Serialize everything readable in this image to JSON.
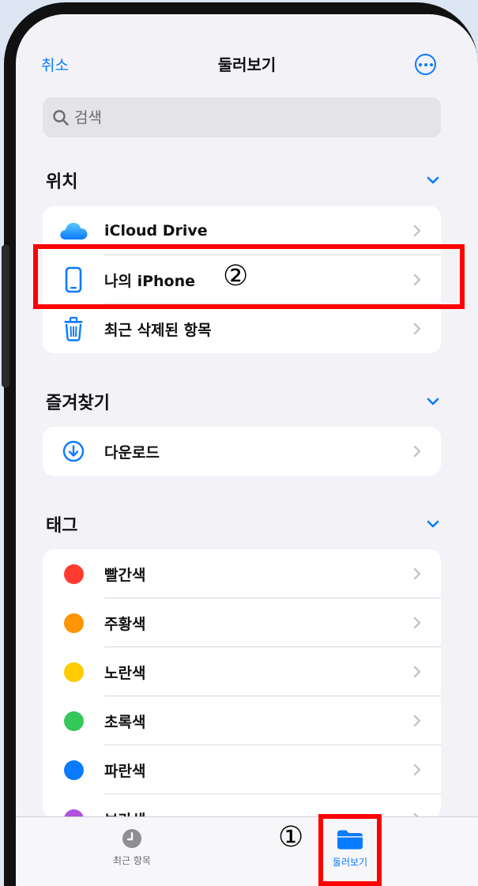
{
  "header": {
    "cancel_label": "취소",
    "title": "둘러보기"
  },
  "search": {
    "placeholder": "검색"
  },
  "sections": {
    "locations": {
      "title": "위치",
      "items": [
        {
          "label": "iCloud Drive",
          "icon": "icloud-icon"
        },
        {
          "label": "나의 iPhone",
          "icon": "iphone-icon"
        },
        {
          "label": "최근 삭제된 항목",
          "icon": "trash-icon"
        }
      ]
    },
    "favorites": {
      "title": "즐겨찾기",
      "items": [
        {
          "label": "다운로드",
          "icon": "download-icon"
        }
      ]
    },
    "tags": {
      "title": "태그",
      "items": [
        {
          "label": "빨간색",
          "color": "#ff3b30"
        },
        {
          "label": "주황색",
          "color": "#ff9500"
        },
        {
          "label": "노란색",
          "color": "#ffcc00"
        },
        {
          "label": "초록색",
          "color": "#34c759"
        },
        {
          "label": "파란색",
          "color": "#0a7aff"
        },
        {
          "label": "보라색",
          "color": "#af52de"
        }
      ]
    }
  },
  "tabbar": {
    "recent_label": "최근 항목",
    "browse_label": "둘러보기"
  },
  "annotations": {
    "step1": "①",
    "step2": "②"
  },
  "colors": {
    "accent": "#0a7aff",
    "annotation": "#ff0000"
  }
}
